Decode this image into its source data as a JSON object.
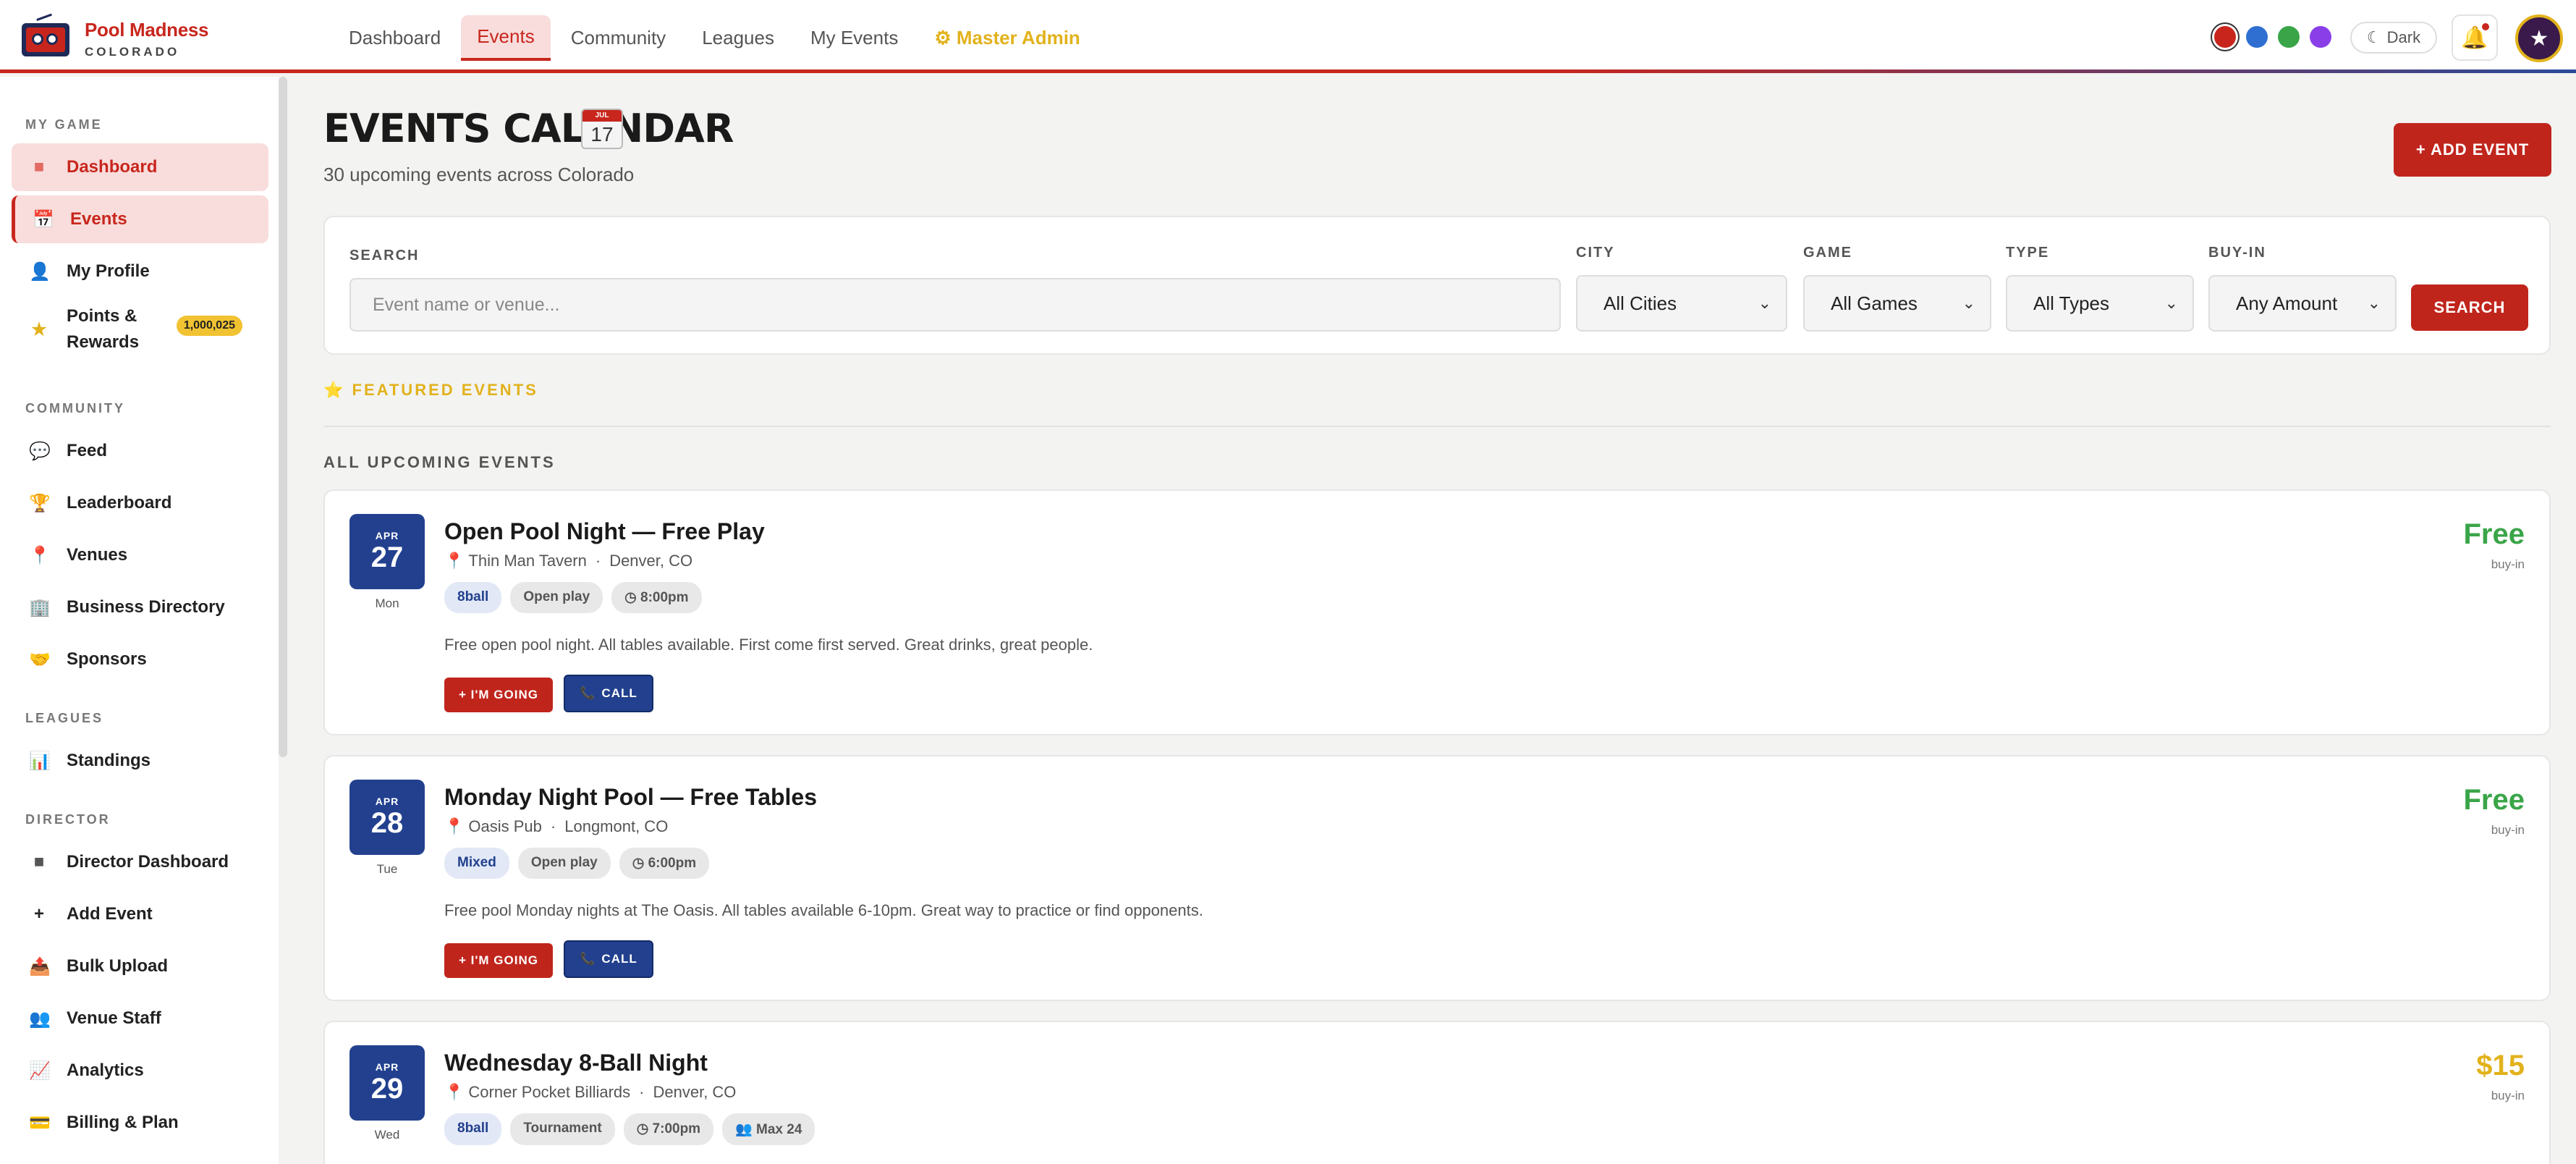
{
  "app": {
    "brand_name": "Pool Madness",
    "brand_sub": "COLORADO"
  },
  "nav": {
    "tabs": [
      "Dashboard",
      "Events",
      "Community",
      "Leagues",
      "My Events"
    ],
    "active_tab": "Events",
    "admin_label": "⚙ Master Admin",
    "dark_label": "Dark",
    "theme_colors": [
      "#c8261d",
      "#2e6fd1",
      "#3aa548",
      "#8a3ee8"
    ]
  },
  "sidebar": {
    "sections": {
      "my_game": "MY GAME",
      "community": "COMMUNITY",
      "leagues": "LEAGUES",
      "director": "DIRECTOR"
    },
    "items": {
      "dashboard": {
        "label": "Dashboard",
        "icon": "grid-icon"
      },
      "events": {
        "label": "Events",
        "icon": "calendar-icon"
      },
      "my_profile": {
        "label": "My Profile",
        "icon": "user-icon"
      },
      "points": {
        "label": "Points & Rewards",
        "icon": "star-icon",
        "badge": "1,000,025"
      },
      "feed": {
        "label": "Feed",
        "icon": "chat-icon"
      },
      "leaderboard": {
        "label": "Leaderboard",
        "icon": "trophy-icon"
      },
      "venues": {
        "label": "Venues",
        "icon": "pin-icon"
      },
      "business_directory": {
        "label": "Business Directory",
        "icon": "building-icon"
      },
      "sponsors": {
        "label": "Sponsors",
        "icon": "handshake-icon"
      },
      "standings": {
        "label": "Standings",
        "icon": "bar-chart-icon"
      },
      "director_dashboard": {
        "label": "Director Dashboard",
        "icon": "square-icon"
      },
      "add_event": {
        "label": "Add Event",
        "icon": "plus-icon"
      },
      "bulk_upload": {
        "label": "Bulk Upload",
        "icon": "upload-icon"
      },
      "venue_staff": {
        "label": "Venue Staff",
        "icon": "people-icon"
      },
      "analytics": {
        "label": "Analytics",
        "icon": "chart-up-icon"
      },
      "billing": {
        "label": "Billing & Plan",
        "icon": "card-icon"
      }
    }
  },
  "main": {
    "title": "EVENTS CALENDAR",
    "calendar_icon_day": "17",
    "calendar_icon_month": "JUL",
    "subtitle": "30 upcoming events across Colorado",
    "add_event_label": "+ ADD EVENT",
    "filters": {
      "search_label": "SEARCH",
      "search_placeholder": "Event name or venue...",
      "city_label": "CITY",
      "city_value": "All Cities",
      "game_label": "GAME",
      "game_value": "All Games",
      "type_label": "TYPE",
      "type_value": "All Types",
      "buyin_label": "BUY-IN",
      "buyin_value": "Any Amount",
      "search_button": "SEARCH"
    },
    "featured_label": "⭐ FEATURED EVENTS",
    "all_upcoming_label": "ALL UPCOMING EVENTS",
    "events": [
      {
        "month": "APR",
        "day": "27",
        "weekday": "Mon",
        "title": "Open Pool Night — Free Play",
        "venue": "Thin Man Tavern",
        "city": "Denver, CO",
        "game": "8ball",
        "type": "Open play",
        "time": "8:00pm",
        "description": "Free open pool night. All tables available. First come first served. Great drinks, great people.",
        "going_label": "+ I'M GOING",
        "call_label": "CALL",
        "price": "Free",
        "price_sub": "buy-in",
        "price_color": "#3aa548"
      },
      {
        "month": "APR",
        "day": "28",
        "weekday": "Tue",
        "title": "Monday Night Pool — Free Tables",
        "venue": "Oasis Pub",
        "city": "Longmont, CO",
        "game": "Mixed",
        "type": "Open play",
        "time": "6:00pm",
        "description": "Free pool Monday nights at The Oasis. All tables available 6-10pm. Great way to practice or find opponents.",
        "going_label": "+ I'M GOING",
        "call_label": "CALL",
        "price": "Free",
        "price_sub": "buy-in",
        "price_color": "#3aa548"
      },
      {
        "month": "APR",
        "day": "29",
        "weekday": "Wed",
        "title": "Wednesday 8-Ball Night",
        "venue": "Corner Pocket Billiards",
        "city": "Denver, CO",
        "game": "8ball",
        "type": "Tournament",
        "time": "7:00pm",
        "max": "Max 24",
        "price": "$15",
        "price_sub": "buy-in",
        "price_color": "#e2b21c"
      }
    ]
  }
}
